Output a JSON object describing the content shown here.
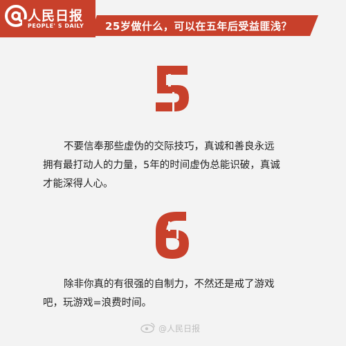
{
  "header": {
    "brand_name": "人民日报",
    "brand_sub": "PEOPLE' S DAILY",
    "title": "25岁做什么，可以在五年后受益匪浅？",
    "brand_color": "#c8402b",
    "title_bar_color": "#c8402b"
  },
  "sections": [
    {
      "number": "5",
      "number_color": "#c8402b",
      "lines": [
        "不要信奉那些虚伪的交际技巧，真诚和善良永远",
        "拥有最打动人的力量，5年的时间虚伪总能识破，真诚",
        "才能深得人心。"
      ]
    },
    {
      "number": "6",
      "number_color": "#c8402b",
      "lines": [
        "除非你真的有很强的自制力，不然还是戒了游戏",
        "吧，玩游戏=浪费时间。"
      ]
    }
  ],
  "watermark": {
    "text": "@人民日报",
    "icon": "weibo-icon"
  }
}
